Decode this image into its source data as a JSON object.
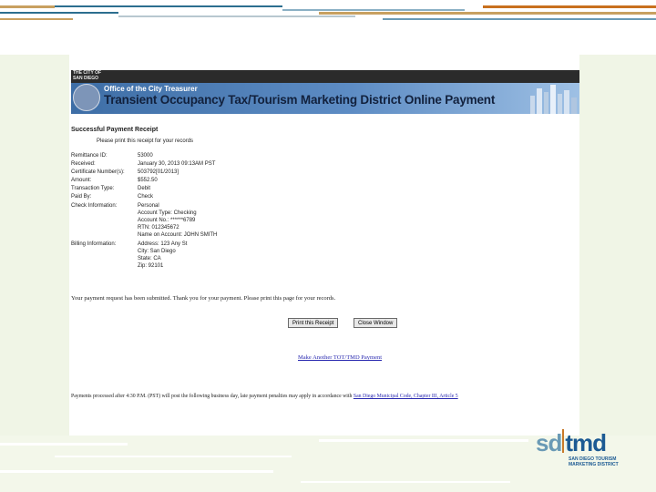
{
  "header": {
    "city_logo_line1": "THE CITY OF",
    "city_logo_line2": "SAN DIEGO",
    "office": "Office of the City Treasurer",
    "title": "Transient Occupancy Tax/Tourism Marketing District Online Payment"
  },
  "receipt": {
    "title": "Successful Payment Receipt",
    "print_note": "Please print this receipt for your records",
    "rows": [
      {
        "label": "Remittance ID:",
        "value": "53000"
      },
      {
        "label": "Received:",
        "value": "January 30, 2013 09:13AM PST"
      },
      {
        "label": "Certificate Number(s):",
        "value": "503792[01/2013]"
      },
      {
        "label": "Amount:",
        "value": "$552.50"
      },
      {
        "label": "Transaction Type:",
        "value": "Debit"
      },
      {
        "label": "Paid By:",
        "value": "Check"
      },
      {
        "label": "Check Information:",
        "value": "Personal"
      },
      {
        "label": "",
        "value": "Account Type: Checking"
      },
      {
        "label": "",
        "value": "Account No.: ******6789"
      },
      {
        "label": "",
        "value": "RTN: 012345672"
      },
      {
        "label": "",
        "value": "Name on Account: JOHN SMITH"
      },
      {
        "label": "Billing Information:",
        "value": "Address: 123 Any St"
      },
      {
        "label": "",
        "value": "City: San Diego"
      },
      {
        "label": "",
        "value": "State: CA"
      },
      {
        "label": "",
        "value": "Zip: 92101"
      }
    ],
    "submitted": "Your payment request has been submitted. Thank you for your payment. Please print this page for your records.",
    "print_button": "Print this Receipt",
    "close_button": "Close Window",
    "another_link": "Make Another TOT/TMD Payment",
    "footer_text": "Payments processed after 4:30 P.M. (PST) will post the following business day, late payment penalties may apply in accordance with ",
    "footer_link": "San Diego Municipal Code, Chapter III, Article 5"
  },
  "logo": {
    "sd": "sd",
    "tmd": "tmd",
    "sub_line1": "SAN DIEGO TOURISM",
    "sub_line2": "MARKETING DISTRICT"
  },
  "colors": {
    "accent_orange": "#c8701e",
    "accent_blue": "#1c5a93",
    "link": "#2a2ab0"
  }
}
